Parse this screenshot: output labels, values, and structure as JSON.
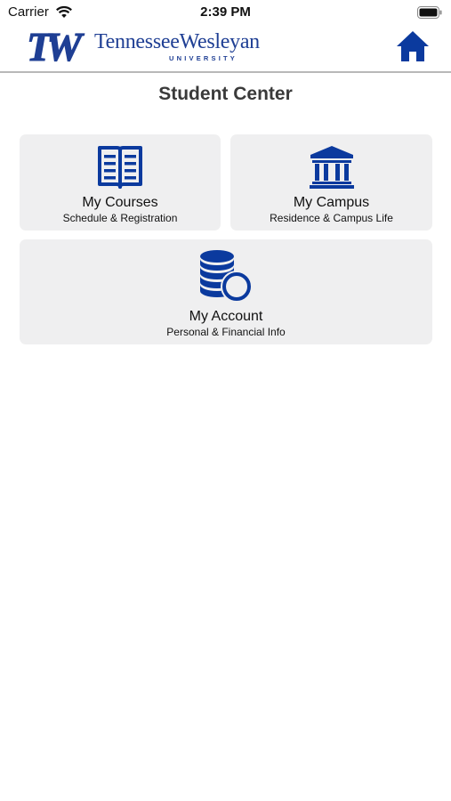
{
  "status_bar": {
    "carrier": "Carrier",
    "time": "2:39 PM"
  },
  "header": {
    "logo_mark": "TW",
    "logo_name": "TennesseeWesleyan",
    "logo_sub": "UNIVERSITY",
    "home_icon": "home-icon"
  },
  "page": {
    "title": "Student Center"
  },
  "tiles": [
    {
      "icon": "open-book-icon",
      "title": "My Courses",
      "subtitle": "Schedule & Registration"
    },
    {
      "icon": "bank-building-icon",
      "title": "My Campus",
      "subtitle": "Residence & Campus Life"
    },
    {
      "icon": "coins-icon",
      "title": "My Account",
      "subtitle": "Personal & Financial Info"
    }
  ],
  "colors": {
    "brand_blue": "#1f3f94",
    "icon_blue": "#0b3a9e",
    "tile_bg": "#efeff0"
  }
}
